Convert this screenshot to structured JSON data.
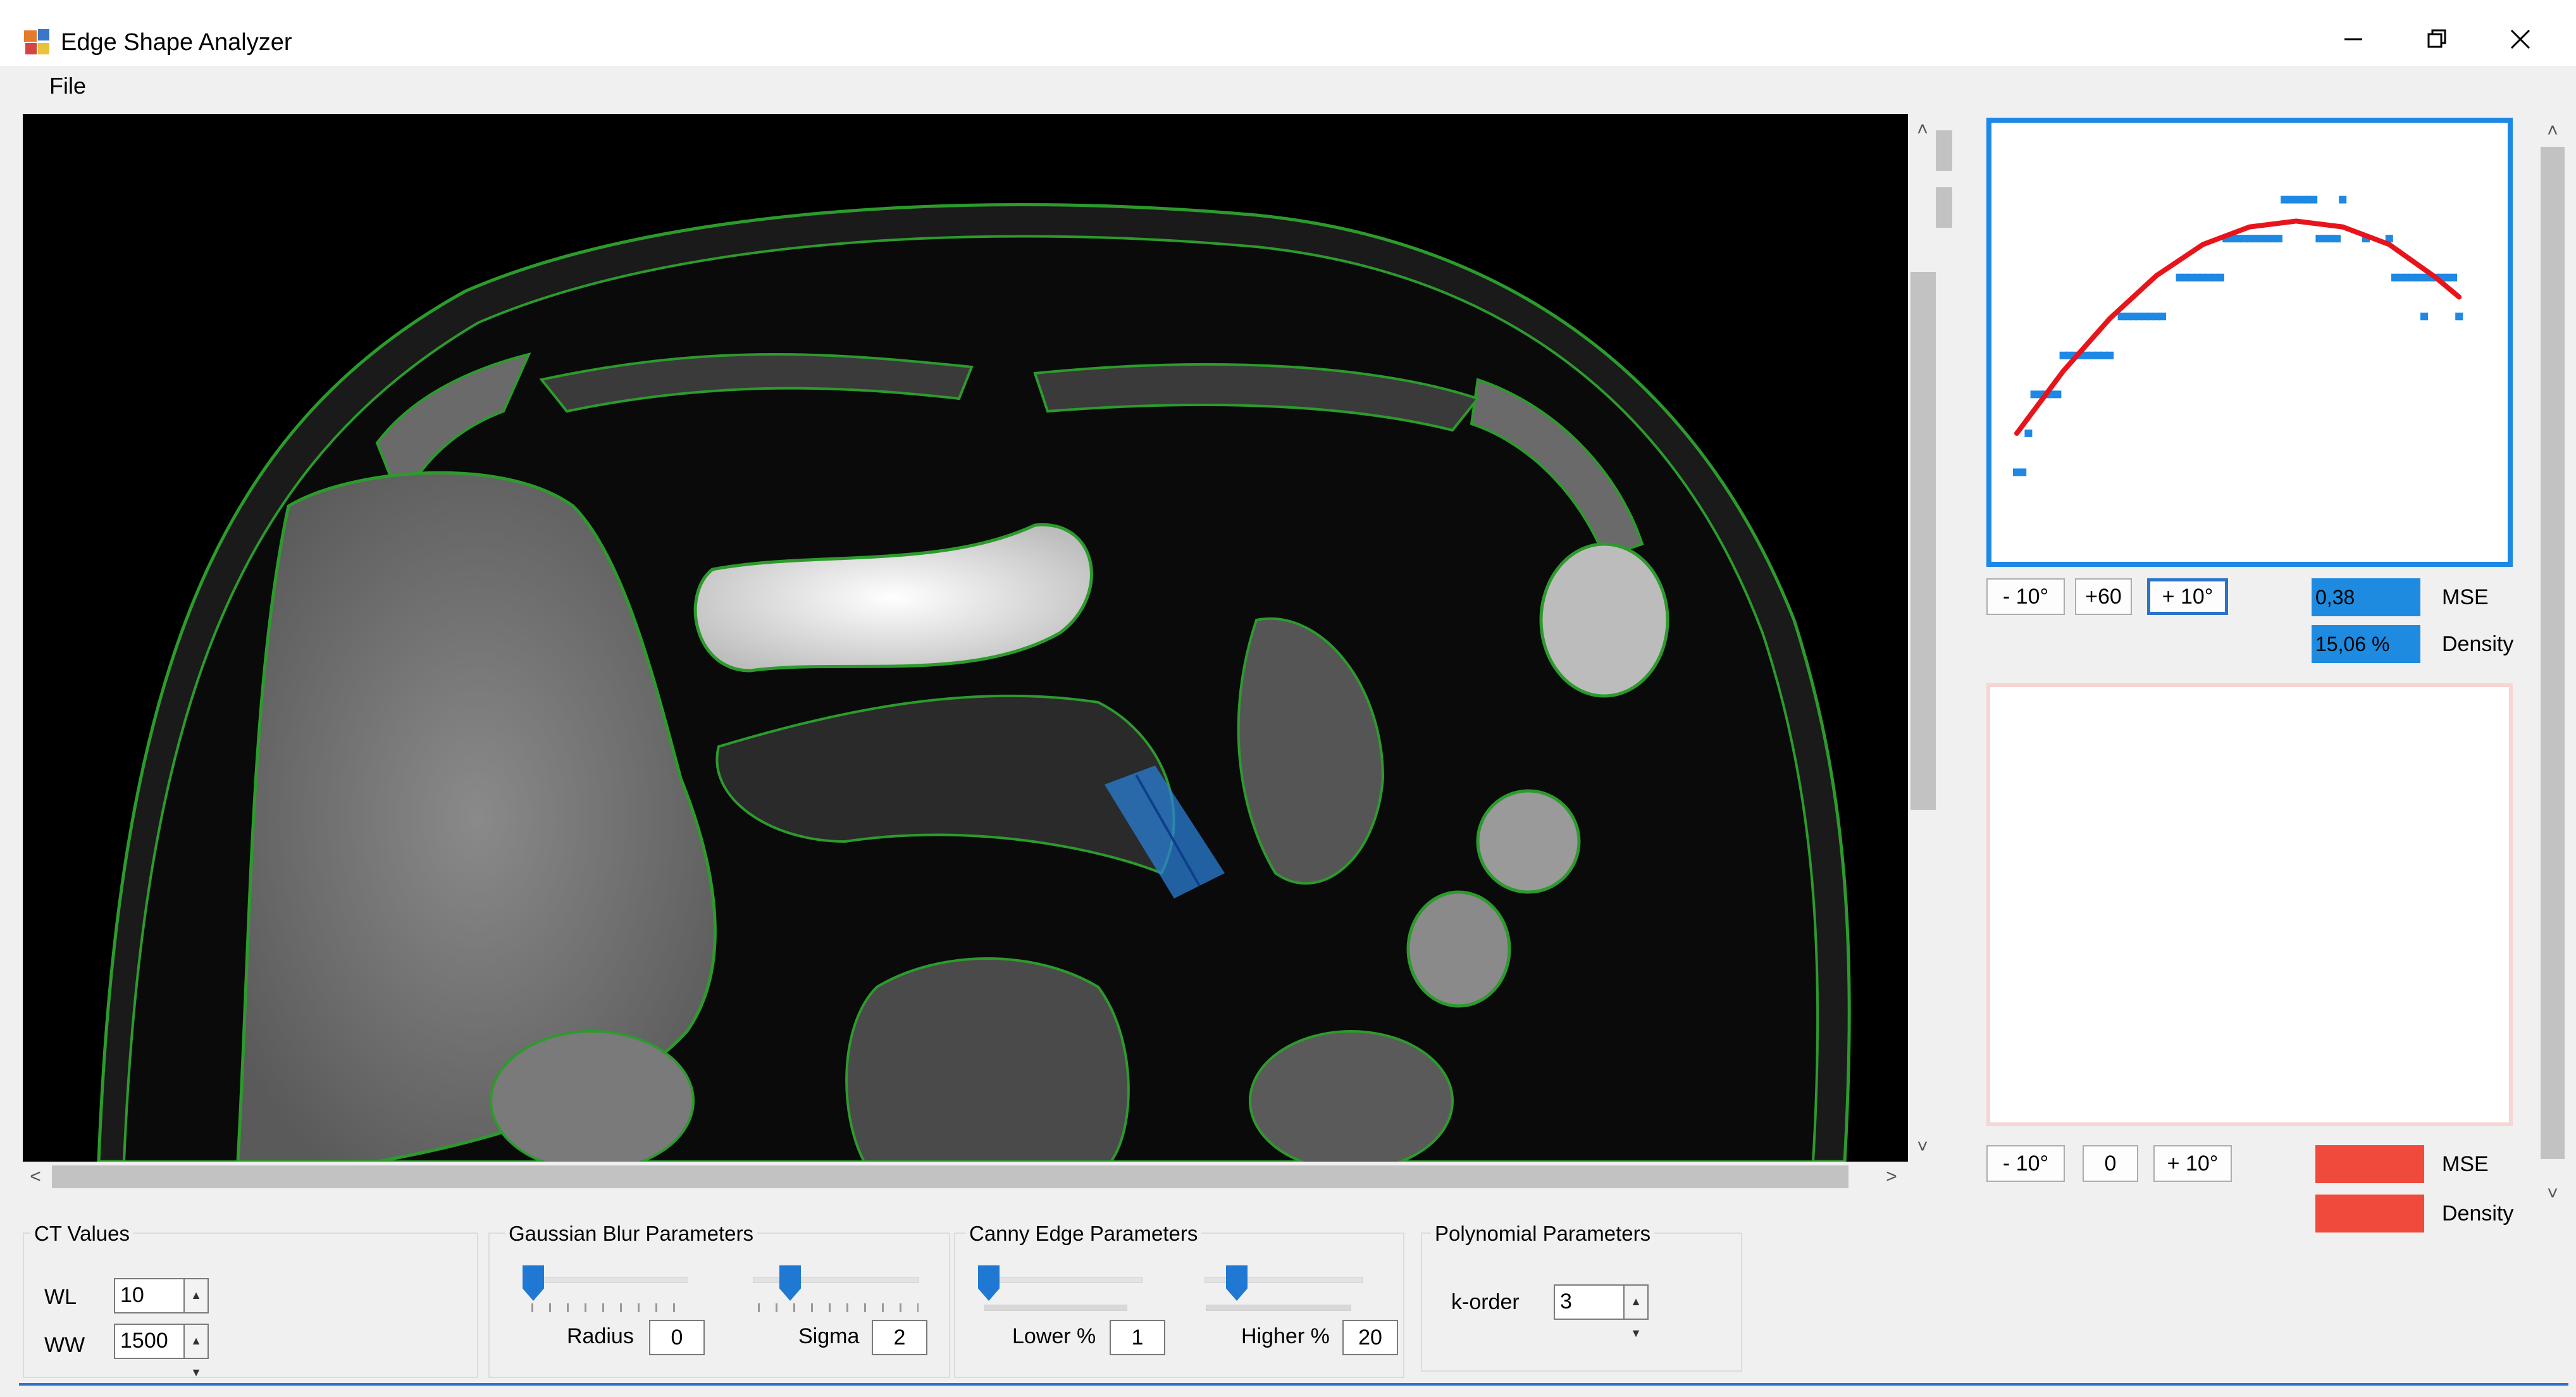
{
  "window": {
    "title": "Edge Shape Analyzer",
    "controls": {
      "minimize": "─",
      "restore": "❐",
      "close": "✕"
    }
  },
  "menu": {
    "file": "File"
  },
  "scrollbars": {
    "up": "˄",
    "down": "˅",
    "left": "<",
    "right": ">"
  },
  "right_panel": {
    "plot1": {
      "buttons": [
        "- 10°",
        "+60",
        "+ 10°"
      ],
      "mse_value": "0,38",
      "mse_label": "MSE",
      "density_value": "15,06 %",
      "density_label": "Density",
      "value_color": "#1e8be0"
    },
    "plot2": {
      "buttons": [
        "- 10°",
        "0",
        "+ 10°"
      ],
      "mse_value": "",
      "mse_label": "MSE",
      "density_value": "",
      "density_label": "Density",
      "value_color": "#f04a3c"
    }
  },
  "chart_data": {
    "type": "scatter",
    "xlim": [
      0,
      40
    ],
    "ylim": [
      0,
      9
    ],
    "series": [
      {
        "kind": "points",
        "color": "#1e88e5",
        "points": [
          [
            0,
            1
          ],
          [
            0.5,
            1
          ],
          [
            1,
            2
          ],
          [
            1.5,
            3
          ],
          [
            2,
            3
          ],
          [
            2.5,
            3
          ],
          [
            3,
            3
          ],
          [
            3.5,
            3
          ],
          [
            4,
            4
          ],
          [
            4.5,
            4
          ],
          [
            5,
            4
          ],
          [
            5.5,
            4
          ],
          [
            6,
            4
          ],
          [
            6.5,
            4
          ],
          [
            7,
            4
          ],
          [
            7.5,
            4
          ],
          [
            8,
            4
          ],
          [
            9,
            5
          ],
          [
            9.5,
            5
          ],
          [
            10,
            5
          ],
          [
            10.5,
            5
          ],
          [
            11,
            5
          ],
          [
            11.5,
            5
          ],
          [
            12,
            5
          ],
          [
            12.5,
            5
          ],
          [
            14,
            6
          ],
          [
            14.5,
            6
          ],
          [
            15,
            6
          ],
          [
            15.5,
            6
          ],
          [
            16,
            6
          ],
          [
            16.5,
            6
          ],
          [
            17,
            6
          ],
          [
            17.5,
            6
          ],
          [
            18,
            7
          ],
          [
            18.5,
            7
          ],
          [
            19,
            7
          ],
          [
            19.5,
            7
          ],
          [
            20,
            7
          ],
          [
            20.5,
            7
          ],
          [
            21,
            7
          ],
          [
            21.5,
            7
          ],
          [
            22,
            7
          ],
          [
            22.5,
            7
          ],
          [
            23,
            8
          ],
          [
            23.5,
            8
          ],
          [
            24,
            8
          ],
          [
            24.5,
            8
          ],
          [
            25,
            8
          ],
          [
            25.5,
            8
          ],
          [
            26,
            7
          ],
          [
            26.5,
            7
          ],
          [
            27,
            7
          ],
          [
            27.5,
            7
          ],
          [
            28,
            8
          ],
          [
            30,
            7
          ],
          [
            32,
            7
          ],
          [
            32.5,
            6
          ],
          [
            33,
            6
          ],
          [
            33.5,
            6
          ],
          [
            34,
            6
          ],
          [
            34.5,
            6
          ],
          [
            35,
            6
          ],
          [
            35.5,
            6
          ],
          [
            36,
            6
          ],
          [
            36.5,
            6
          ],
          [
            37,
            6
          ],
          [
            37.5,
            6
          ],
          [
            35,
            5
          ],
          [
            38,
            5
          ]
        ]
      },
      {
        "kind": "fit",
        "color": "#e8141b",
        "points": [
          [
            0,
            2
          ],
          [
            4,
            3.6
          ],
          [
            8,
            4.95
          ],
          [
            12,
            6.05
          ],
          [
            16,
            6.85
          ],
          [
            20,
            7.3
          ],
          [
            24,
            7.45
          ],
          [
            28,
            7.3
          ],
          [
            32,
            6.85
          ],
          [
            36,
            6
          ],
          [
            38,
            5.5
          ]
        ]
      }
    ]
  },
  "ct_values": {
    "title": "CT Values",
    "wl_label": "WL",
    "wl_value": "10",
    "ww_label": "WW",
    "ww_value": "1500"
  },
  "gaussian": {
    "title": "Gaussian Blur Parameters",
    "radius_label": "Radius",
    "radius_value": "0",
    "sigma_label": "Sigma",
    "sigma_value": "2"
  },
  "canny": {
    "title": "Canny Edge Parameters",
    "lower_label": "Lower %",
    "lower_value": "1",
    "higher_label": "Higher %",
    "higher_value": "20"
  },
  "polynomial": {
    "title": "Polynomial Parameters",
    "k_label": "k-order",
    "k_value": "3"
  }
}
